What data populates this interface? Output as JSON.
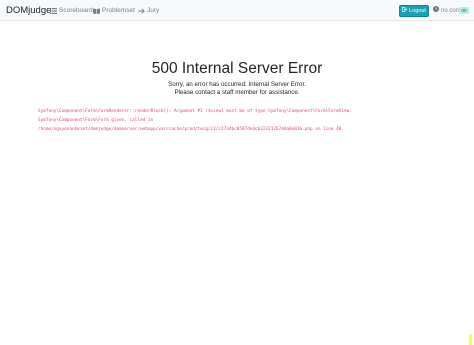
{
  "navbar": {
    "brand": "DOMjudge",
    "items": [
      {
        "label": "Scoreboard",
        "icon": "list-icon"
      },
      {
        "label": "Problemset",
        "icon": "book-icon"
      },
      {
        "label": "Jury",
        "icon": "arrow-right-icon"
      }
    ],
    "logout_label": "Logout",
    "status_text": "no contest",
    "clock_badge": "00"
  },
  "error": {
    "title": "500 Internal Server Error",
    "line1": "Sorry, an error has occurred: Internal Server Error.",
    "line2": "Please contact a staff member for assistance.",
    "trace_lines": [
      "Symfony\\Component\\Form\\FormRenderer::renderBlock(): Argument #1 ($view) must be of type Symfony\\Component\\Form\\FormView,",
      "Symfony\\Component\\Form\\Form given, called in",
      "/home/nguyenanhkiet/domjudge/domserver/webapp/var/cache/prod/twig/c2/c27a4bc0587de4cb32321267dda8e03b.php on line 40"
    ]
  },
  "colors": {
    "navbar_bg": "#f8f9fa",
    "accent": "#17a2b8",
    "trace": "#e83e8c",
    "badge": "#b9eee6"
  }
}
